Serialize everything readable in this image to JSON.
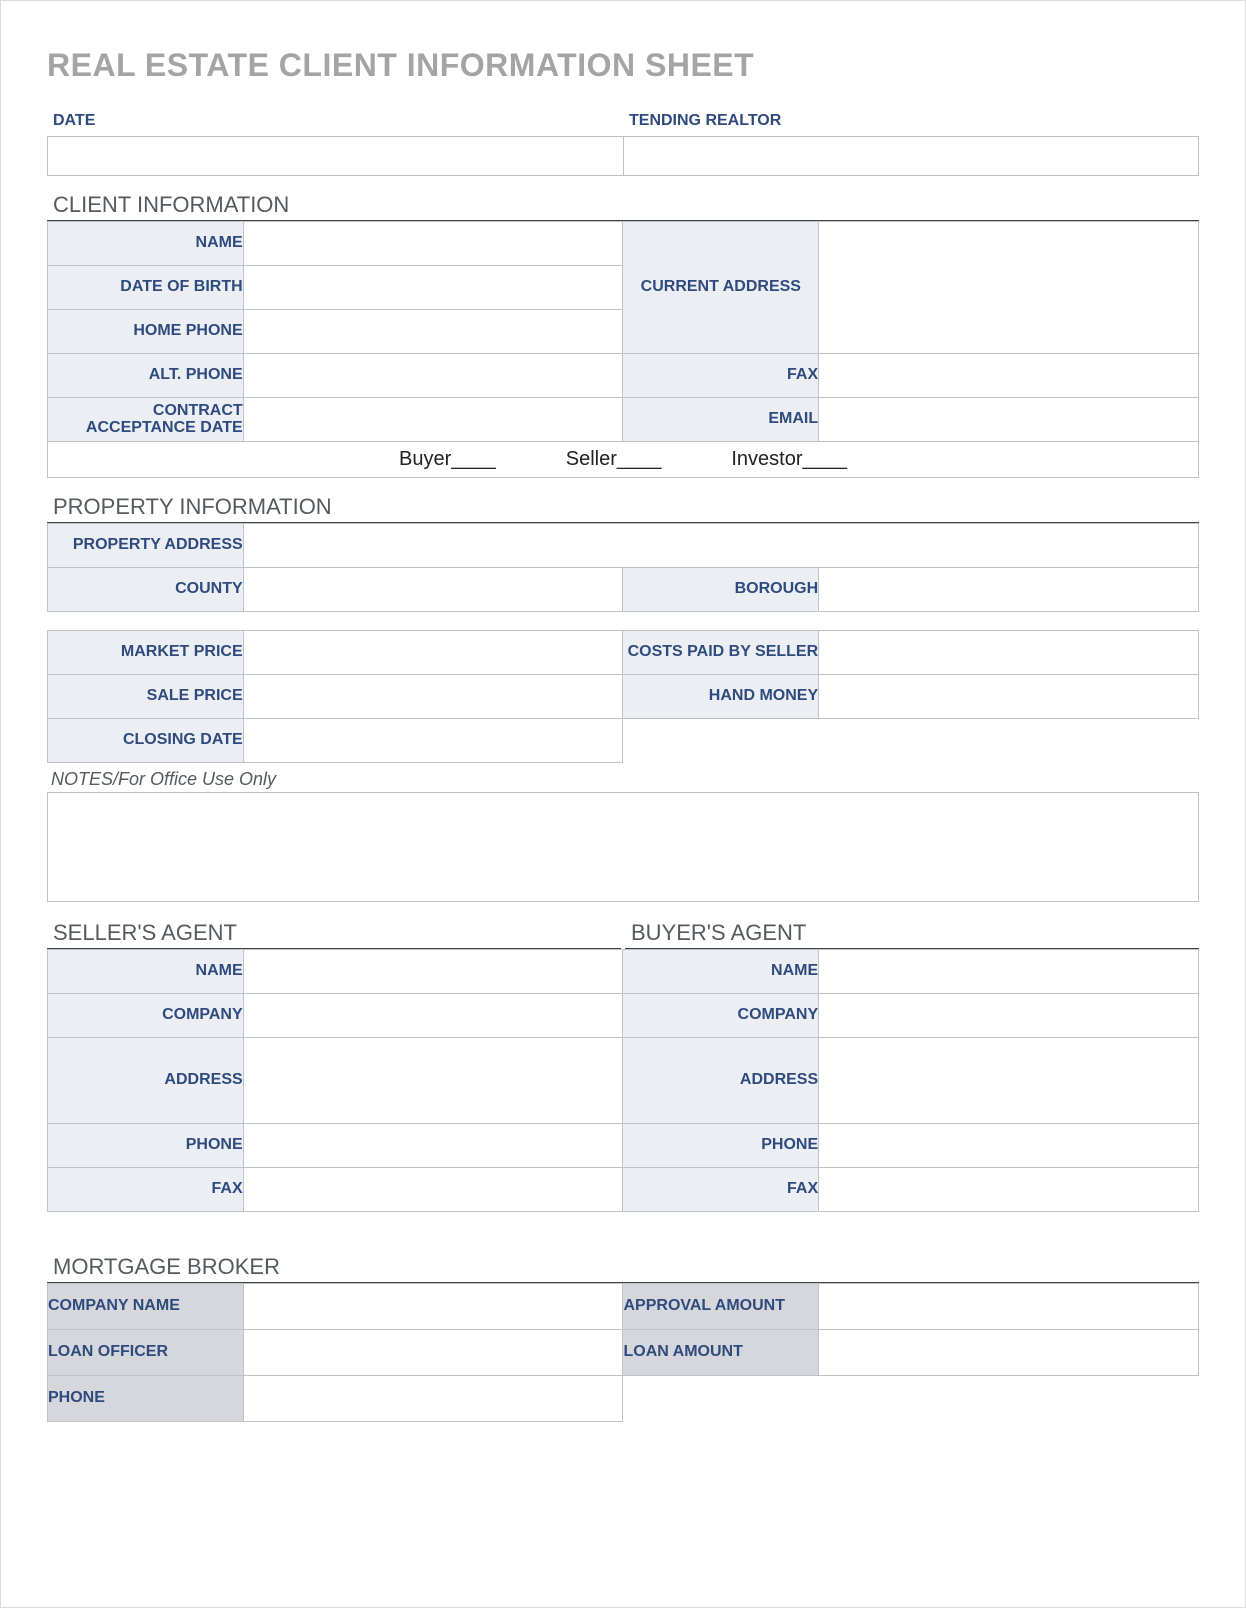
{
  "title": "REAL ESTATE CLIENT INFORMATION SHEET",
  "top": {
    "date_label": "DATE",
    "date_value": "",
    "realtor_label": "TENDING REALTOR",
    "realtor_value": ""
  },
  "client": {
    "header": "CLIENT INFORMATION",
    "name_label": "NAME",
    "name_value": "",
    "dob_label": "DATE OF BIRTH",
    "dob_value": "",
    "home_phone_label": "HOME PHONE",
    "home_phone_value": "",
    "alt_phone_label": "ALT. PHONE",
    "alt_phone_value": "",
    "contract_date_label": "CONTRACT ACCEPTANCE DATE",
    "contract_date_value": "",
    "current_address_label": "CURRENT ADDRESS",
    "current_address_value": "",
    "fax_label": "FAX",
    "fax_value": "",
    "email_label": "EMAIL",
    "email_value": "",
    "role_buyer": "Buyer____",
    "role_seller": "Seller____",
    "role_investor": "Investor____"
  },
  "property": {
    "header": "PROPERTY INFORMATION",
    "address_label": "PROPERTY ADDRESS",
    "address_value": "",
    "county_label": "COUNTY",
    "county_value": "",
    "borough_label": "BOROUGH",
    "borough_value": "",
    "market_price_label": "MARKET PRICE",
    "market_price_value": "",
    "sale_price_label": "SALE PRICE",
    "sale_price_value": "",
    "closing_date_label": "CLOSING DATE",
    "closing_date_value": "",
    "costs_label": "COSTS PAID BY SELLER",
    "costs_value": "",
    "hand_money_label": "HAND MONEY",
    "hand_money_value": ""
  },
  "notes": {
    "label": "NOTES/For Office Use Only",
    "value": ""
  },
  "seller_agent": {
    "header": "SELLER'S AGENT",
    "name_label": "NAME",
    "name_value": "",
    "company_label": "COMPANY",
    "company_value": "",
    "address_label": "ADDRESS",
    "address_value": "",
    "phone_label": "PHONE",
    "phone_value": "",
    "fax_label": "FAX",
    "fax_value": ""
  },
  "buyer_agent": {
    "header": "BUYER'S AGENT",
    "name_label": "NAME",
    "name_value": "",
    "company_label": "COMPANY",
    "company_value": "",
    "address_label": "ADDRESS",
    "address_value": "",
    "phone_label": "PHONE",
    "phone_value": "",
    "fax_label": "FAX",
    "fax_value": ""
  },
  "broker": {
    "header": "MORTGAGE BROKER",
    "company_label": "COMPANY NAME",
    "company_value": "",
    "officer_label": "LOAN OFFICER",
    "officer_value": "",
    "phone_label": "PHONE",
    "phone_value": "",
    "approval_label": "APPROVAL AMOUNT",
    "approval_value": "",
    "loan_label": "LOAN AMOUNT",
    "loan_value": ""
  }
}
